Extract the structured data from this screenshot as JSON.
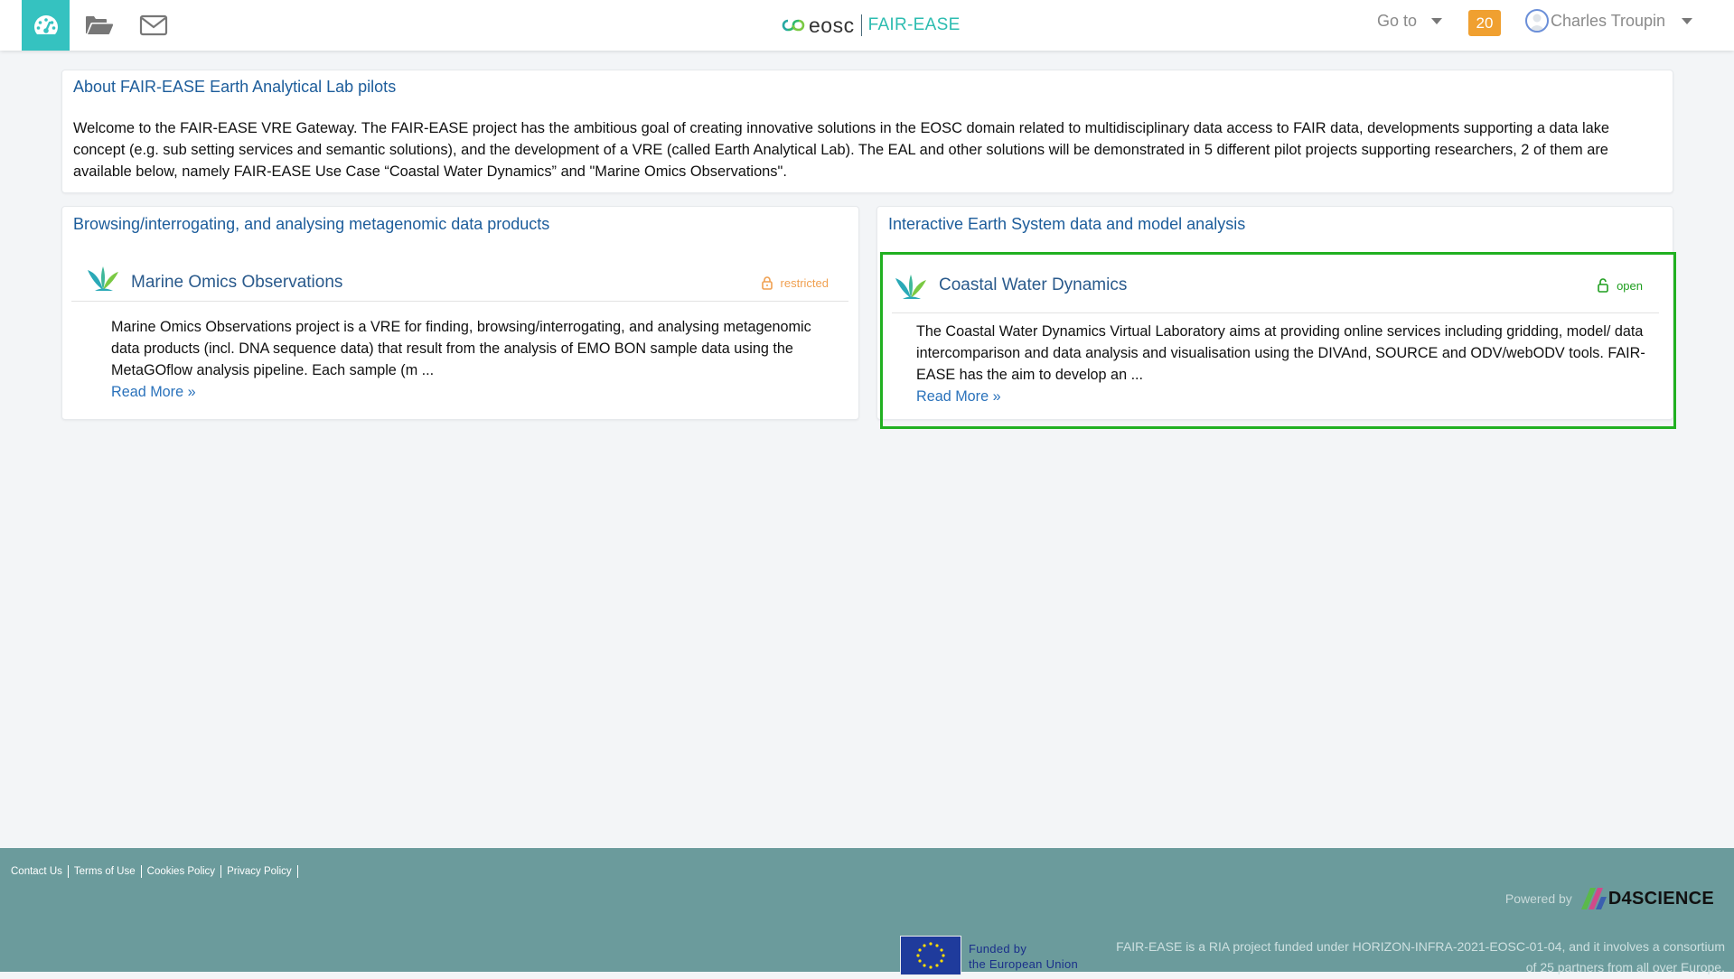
{
  "nav": {
    "brand_eosc": "eosc",
    "brand_fair": "FAIR-EASE",
    "goto_label": "Go to",
    "notifications_count": "20",
    "user_name": "Charles Troupin",
    "icons": [
      "dashboard-icon",
      "folder-open-icon",
      "envelope-icon"
    ],
    "active_color": "#35c2c0"
  },
  "about": {
    "title": "About FAIR-EASE Earth Analytical Lab pilots",
    "body": "Welcome to the FAIR-EASE VRE Gateway.  The FAIR-EASE project has the ambitious goal of creating innovative solutions in the EOSC domain related to multidisciplinary data access to FAIR data, developments supporting a data lake concept (e.g. sub setting services and semantic solutions), and the development of a VRE (called Earth Analytical Lab). The EAL and other solutions will be demonstrated in 5 different pilot projects supporting researchers, 2 of them are available below, namely  FAIR-EASE Use Case “Coastal Water Dynamics” and \"Marine Omics Observations\"."
  },
  "sections": [
    {
      "title": "Browsing/interrogating, and analysing metagenomic data products",
      "card": {
        "name": "Marine Omics Observations",
        "access": "restricted",
        "access_color": "#f0a050",
        "description": "Marine Omics Observations project is a VRE for finding, browsing/interrogating, and analysing metagenomic data products (incl. DNA sequence data) that result from the analysis of EMO BON sample data using the MetaGOflow analysis pipeline. Each sample (m ...",
        "read_more": "Read More »"
      }
    },
    {
      "title": "Interactive Earth System data and model analysis",
      "card": {
        "name": "Coastal Water Dynamics",
        "access": "open",
        "access_color": "#1e9e1e",
        "description": "The Coastal Water Dynamics Virtual Laboratory aims at providing online services including gridding, model/ data intercomparison and data analysis and visualisation using the DIVAnd, SOURCE and ODV/webODV tools. FAIR-EASE has the aim to develop an ...",
        "read_more": "Read More »",
        "highlight_color": "#21b021"
      }
    }
  ],
  "footer": {
    "links": [
      "Contact Us",
      "Terms of Use",
      "Cookies Policy",
      "Privacy Policy"
    ],
    "powered_by": "Powered by",
    "powered_brand": "D4SCIENCE",
    "eu_line1": "Funded by",
    "eu_line2": "the European Union",
    "funding_line1": "FAIR-EASE is a RIA project funded under HORIZON-INFRA-2021-EOSC-01-04, and it involves a consortium",
    "funding_line2": "of 25 partners from all over Europe.",
    "bg_color": "#6b9b9c"
  }
}
